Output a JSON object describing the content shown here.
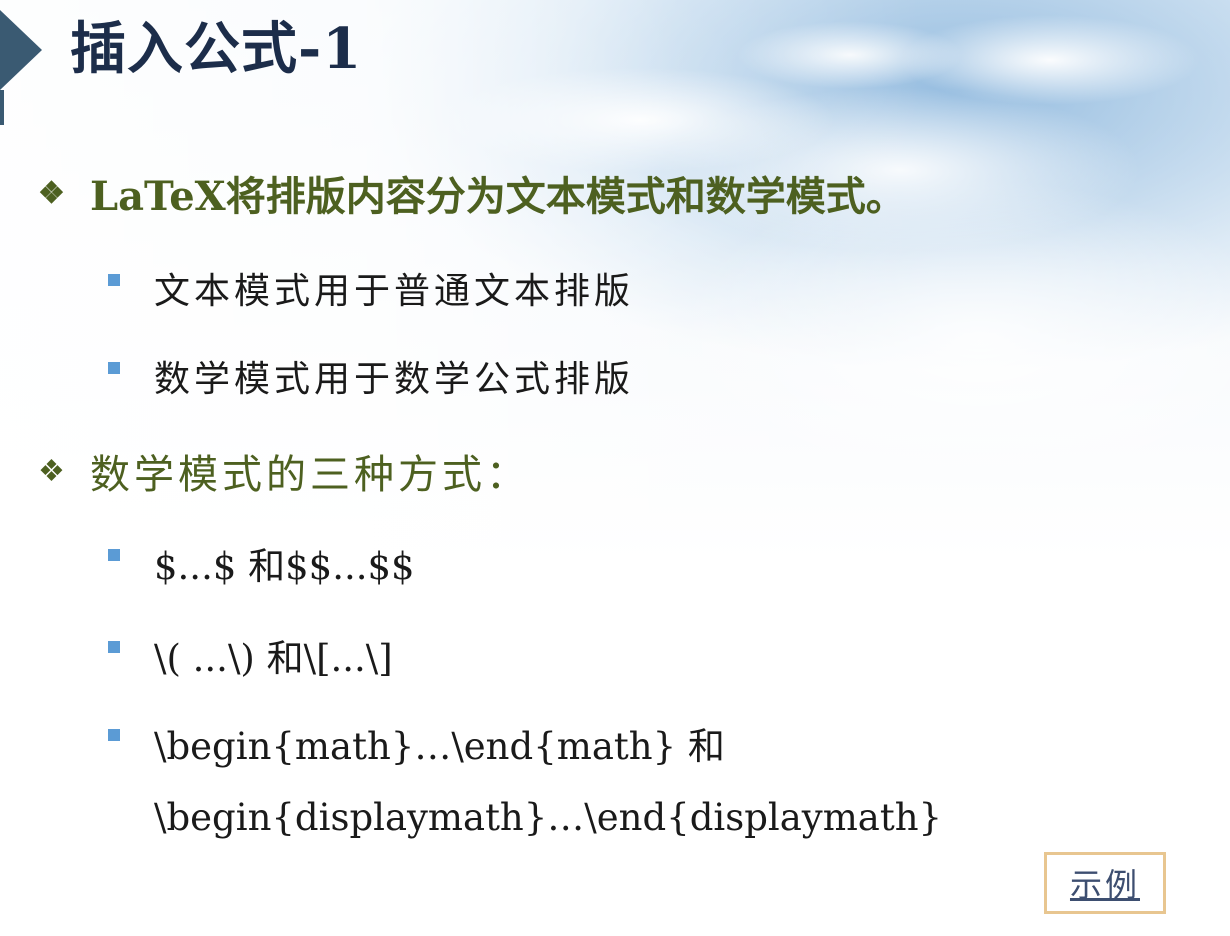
{
  "slide": {
    "title": "插入公式-1",
    "bullets": [
      {
        "marker": "❖",
        "text": "LaTeX将排版内容分为文本模式和数学模式。",
        "subitems": [
          "文本模式用于普通文本排版",
          "数学模式用于数学公式排版"
        ]
      },
      {
        "marker": "❖",
        "text": "数学模式的三种方式：",
        "subitems": [
          "$...$ 和$$...$$",
          "\\( ...\\) 和\\[...\\]",
          "\\begin{math}…\\end{math} 和",
          "\\begin{displaymath}…\\end{displaymath}"
        ]
      }
    ],
    "example_button": "示例"
  },
  "colors": {
    "title": "#1c2d4a",
    "level1_text": "#4d6020",
    "level2_marker": "#5b9bd5",
    "accent_arrow": "#3a5a72",
    "button_border": "#e8c690"
  }
}
